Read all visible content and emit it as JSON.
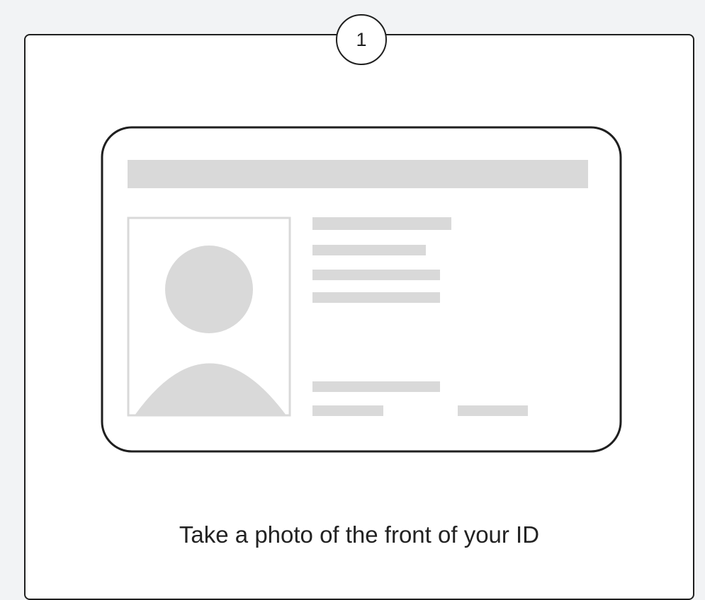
{
  "step": {
    "number": "1"
  },
  "instruction": {
    "text": "Take a photo of the front of your ID"
  },
  "illustration": {
    "icon": "id-card-front-icon",
    "placeholder_color": "#d9d9d9",
    "outline_color": "#1f1f1f"
  }
}
